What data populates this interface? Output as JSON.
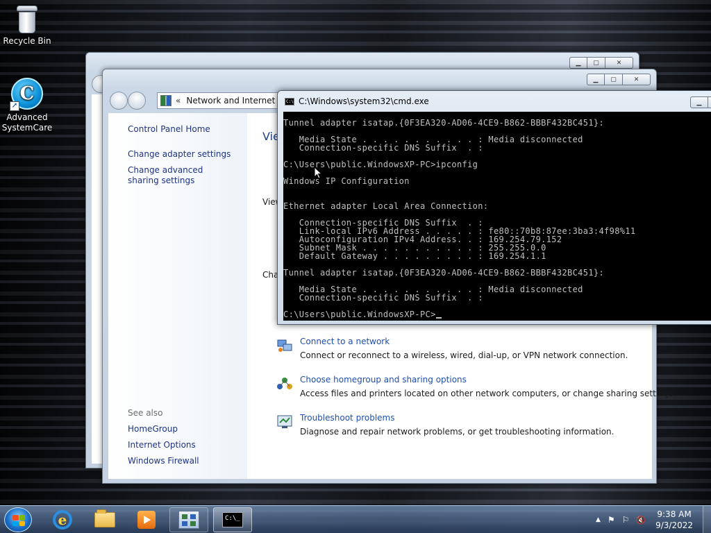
{
  "desktop": {
    "icons": [
      {
        "label": "Recycle Bin"
      },
      {
        "label": "Advanced SystemCare"
      }
    ]
  },
  "explorer": {
    "address_crumbs": [
      "«",
      "Network and Internet",
      "▸"
    ],
    "left_pane": {
      "home": "Control Panel Home",
      "links": [
        "Change adapter settings",
        "Change advanced sharing settings"
      ],
      "see_also_title": "See also",
      "see_also": [
        "HomeGroup",
        "Internet Options",
        "Windows Firewall"
      ]
    },
    "partial_texts": {
      "heading": "Vie",
      "view": "View",
      "change": "Cha"
    },
    "tasks": [
      {
        "link": "Connect to a network",
        "desc": "Connect or reconnect to a wireless, wired, dial-up, or VPN network connection."
      },
      {
        "link": "Choose homegroup and sharing options",
        "desc": "Access files and printers located on other network computers, or change sharing settings."
      },
      {
        "link": "Troubleshoot problems",
        "desc": "Diagnose and repair network problems, or get troubleshooting information."
      }
    ]
  },
  "cmd": {
    "title": "C:\\Windows\\system32\\cmd.exe",
    "lines": [
      "Tunnel adapter isatap.{0F3EA320-AD06-4CE9-B862-BBBF432BC451}:",
      "",
      "   Media State . . . . . . . . . . . : Media disconnected",
      "   Connection-specific DNS Suffix  . :",
      "",
      "C:\\Users\\public.WindowsXP-PC>ipconfig",
      "",
      "Windows IP Configuration",
      "",
      "",
      "Ethernet adapter Local Area Connection:",
      "",
      "   Connection-specific DNS Suffix  . :",
      "   Link-local IPv6 Address . . . . . : fe80::70b8:87ee:3ba3:4f98%11",
      "   Autoconfiguration IPv4 Address. . : 169.254.79.152",
      "   Subnet Mask . . . . . . . . . . . : 255.255.0.0",
      "   Default Gateway . . . . . . . . . : 169.254.1.1",
      "",
      "Tunnel adapter isatap.{0F3EA320-AD06-4CE9-B862-BBBF432BC451}:",
      "",
      "   Media State . . . . . . . . . . . : Media disconnected",
      "   Connection-specific DNS Suffix  . :",
      ""
    ],
    "prompt": "C:\\Users\\public.WindowsXP-PC>"
  },
  "taskbar": {
    "time": "9:38 AM",
    "date": "9/3/2022",
    "tray_symbols": [
      "▲",
      "⚑",
      "⚐",
      "🔇"
    ]
  },
  "colors": {
    "link": "#1e4fae",
    "console_bg": "#000000",
    "console_fg": "#c0c0c0"
  }
}
